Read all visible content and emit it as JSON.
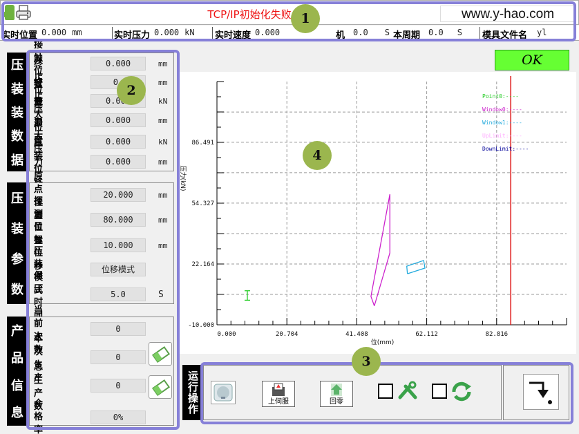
{
  "titlebar": {
    "status": "TCP/IP初始化失败",
    "url": "www.y-hao.com"
  },
  "realtime": {
    "items": [
      {
        "label": "实时位置",
        "value": "0.000",
        "unit": "mm"
      },
      {
        "label": "实时压力",
        "value": "0.000",
        "unit": "kN"
      },
      {
        "label": "实时速度",
        "value": "0.000",
        "unit": ""
      },
      {
        "label": "机",
        "value": "0.0",
        "unit": "S"
      },
      {
        "label": "本周期",
        "value": "0.0",
        "unit": "S"
      },
      {
        "label": "模具文件名",
        "value": "yl",
        "unit": ""
      }
    ]
  },
  "panel_press_data": {
    "title_chars": [
      "压",
      "装",
      "装",
      "数",
      "据"
    ],
    "rows": [
      {
        "label": "接触位置",
        "value": "0.000",
        "unit": "mm"
      },
      {
        "label": "终止位置",
        "value": "0.",
        "unit": "mm"
      },
      {
        "label": "终止压力",
        "value": "0.000",
        "unit": "kN"
      },
      {
        "label": "最大位置",
        "value": "0.000",
        "unit": "mm"
      },
      {
        "label": "最大压力",
        "value": "0.000",
        "unit": "kN"
      },
      {
        "label": "压装位移",
        "value": "0.000",
        "unit": "mm"
      }
    ]
  },
  "panel_press_params": {
    "title_chars": [
      "压",
      "装",
      "参",
      "数"
    ],
    "rows": [
      {
        "label": "原点位置",
        "value": "20.000",
        "unit": "mm"
      },
      {
        "label": "探测位置",
        "value": "80.000",
        "unit": "mm"
      },
      {
        "label": "目标位移",
        "value": "10.000",
        "unit": "mm"
      },
      {
        "label": "压装模式",
        "value": "位移模式",
        "unit": ""
      },
      {
        "label": "保压时间",
        "value": "5.0",
        "unit": "S"
      }
    ]
  },
  "panel_product": {
    "title_chars": [
      "产",
      "品",
      "信",
      "息"
    ],
    "rows": [
      {
        "label": "当前次数",
        "value": "0"
      },
      {
        "label": "本次生产",
        "value": "0"
      },
      {
        "label": "总生产数",
        "value": "0"
      },
      {
        "label": "合格率",
        "value": "0%"
      }
    ]
  },
  "result": {
    "label": "OK",
    "color": "#66ff33"
  },
  "chart_data": {
    "type": "line",
    "ylabel": "压力(kN)",
    "xlabel": "位(mm)",
    "xlim": [
      0,
      103.52
    ],
    "ylim": [
      -10.0,
      118.6
    ],
    "x_ticks": [
      "0.000",
      "20.704",
      "41.408",
      "62.112",
      "82.816"
    ],
    "y_ticks": [
      "-10.000",
      "22.164",
      "54.327",
      "86.491"
    ],
    "legend": [
      {
        "name": "Point0:",
        "value": "----",
        "color": "#22cc22"
      },
      {
        "name": "Window0:",
        "value": "----",
        "color": "#cc22cc"
      },
      {
        "name": "Window1:",
        "value": "----",
        "color": "#22aadd"
      },
      {
        "name": "UpLimit:",
        "value": "----",
        "color": "#ffaaff"
      },
      {
        "name": "DownLimit:",
        "value": "----",
        "color": "#000099"
      }
    ],
    "series": [
      {
        "name": "Window0",
        "color": "#cc22cc",
        "points": [
          [
            46.6,
            0.0
          ],
          [
            51.2,
            28.0
          ],
          [
            51.2,
            59.0
          ],
          [
            45.6,
            5.0
          ],
          [
            46.6,
            0.0
          ]
        ]
      },
      {
        "name": "Window1",
        "color": "#22aadd",
        "points": [
          [
            56.4,
            17.0
          ],
          [
            61.6,
            20.0
          ],
          [
            61.2,
            24.0
          ],
          [
            56.2,
            21.0
          ],
          [
            56.4,
            17.0
          ]
        ]
      },
      {
        "name": "Point0",
        "color": "#22cc22",
        "points": [
          [
            9.0,
            3.0
          ],
          [
            9.0,
            8.0
          ]
        ]
      }
    ],
    "vline": {
      "x": 87.0,
      "color": "#dd1111"
    },
    "grid": true
  },
  "ops": {
    "title": "运行操作",
    "buttons": [
      {
        "label": ""
      },
      {
        "label": "上伺服"
      },
      {
        "label": "回零"
      }
    ]
  },
  "callouts": [
    "1",
    "2",
    "3",
    "4"
  ]
}
